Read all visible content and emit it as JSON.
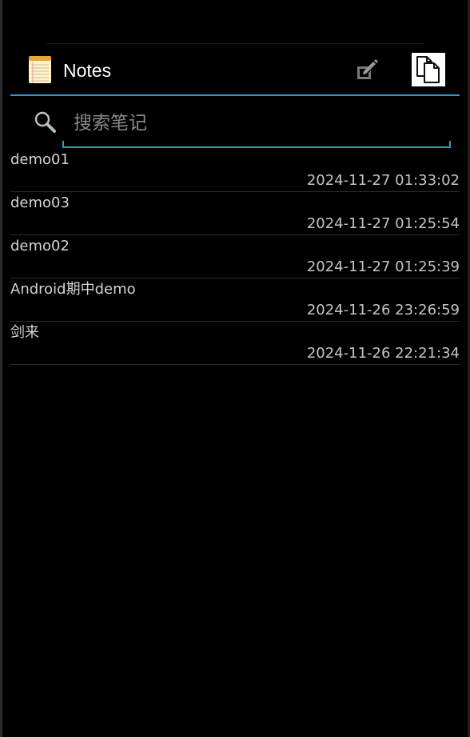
{
  "action_bar": {
    "title": "Notes",
    "icons": {
      "app": "notepad-icon",
      "edit": "compose-icon",
      "paste": "paste-icon"
    }
  },
  "search": {
    "placeholder": "搜索笔记",
    "value": "",
    "icon": "search-icon"
  },
  "notes": [
    {
      "title": "demo01",
      "time": "2024-11-27 01:33:02"
    },
    {
      "title": "demo03",
      "time": "2024-11-27 01:25:54"
    },
    {
      "title": "demo02",
      "time": "2024-11-27 01:25:39"
    },
    {
      "title": "Android期中demo",
      "time": "2024-11-26 23:26:59"
    },
    {
      "title": "剑来",
      "time": "2024-11-26 22:21:34"
    }
  ],
  "colors": {
    "accent": "#2f9ad2",
    "background": "#000000",
    "text_primary": "#d4d4d4",
    "text_secondary": "#c4c4c4"
  }
}
